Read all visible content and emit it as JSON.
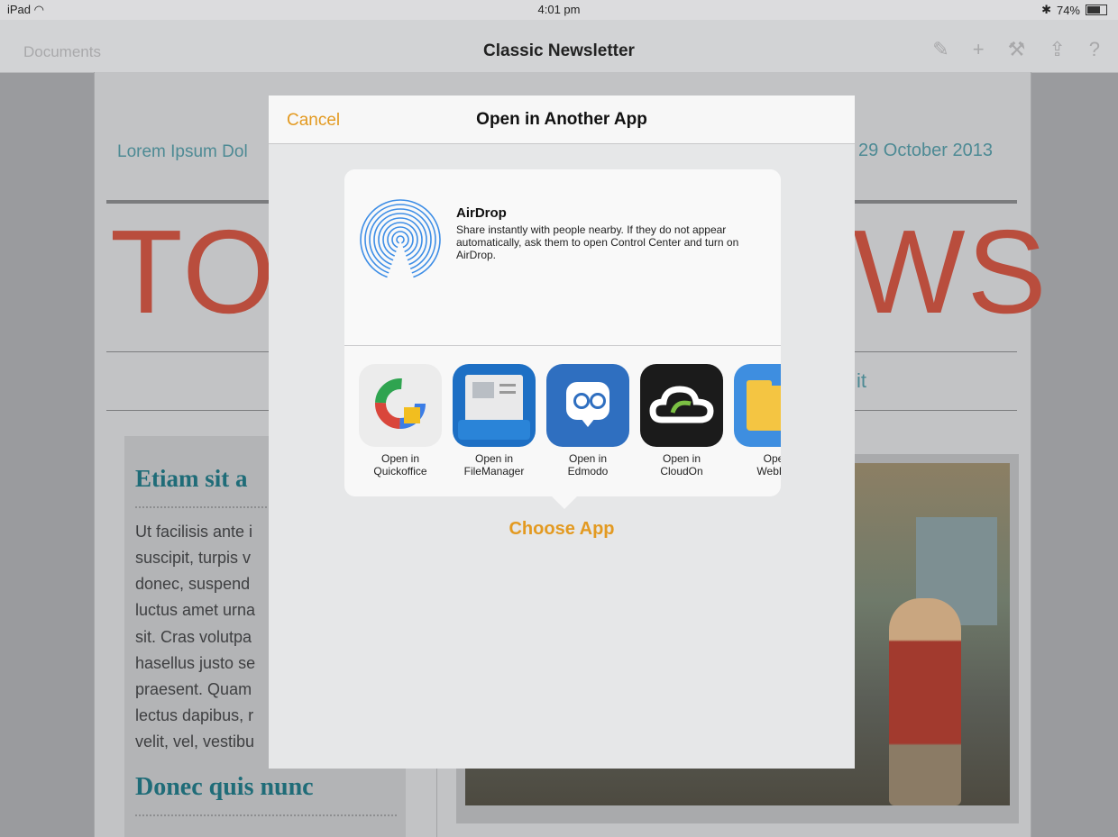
{
  "status_bar": {
    "device": "iPad",
    "time": "4:01 pm",
    "battery": "74%"
  },
  "nav_bar": {
    "back_label": "Documents",
    "title": "Classic Newsletter",
    "tools": [
      "brush-icon",
      "plus-icon",
      "wrench-icon",
      "share-icon",
      "help-icon"
    ]
  },
  "document": {
    "date_left": "Lorem Ipsum Dol",
    "date_right": "29 October 2013",
    "masthead_left": "TO",
    "masthead_right": "WS",
    "subhead_fragment": "it",
    "heading1": "Etiam sit a",
    "body_lines": [
      "Ut facilisis ante i",
      "suscipit, turpis v",
      "donec, suspend",
      "luctus amet urna",
      "sit. Cras volutpa",
      "hasellus justo se",
      "praesent. Quam",
      "lectus dapibus, r",
      "velit, vel, vestibu"
    ],
    "heading2": "Donec quis nunc"
  },
  "dialog": {
    "cancel_label": "Cancel",
    "title": "Open in Another App",
    "airdrop": {
      "title": "AirDrop",
      "description": "Share instantly with people nearby. If they do not appear automatically, ask them to open Control Center and turn on AirDrop."
    },
    "apps": [
      {
        "line1": "Open in",
        "line2": "Quickoffice"
      },
      {
        "line1": "Open in",
        "line2": "FileManager"
      },
      {
        "line1": "Open in",
        "line2": "Edmodo"
      },
      {
        "line1": "Open in",
        "line2": "CloudOn"
      },
      {
        "line1": "Oper",
        "line2": "WebDA"
      }
    ],
    "choose_app_label": "Choose App"
  },
  "colors": {
    "accent": "#e39a21",
    "teal": "#1f6c78",
    "masthead": "#b94d3d"
  }
}
